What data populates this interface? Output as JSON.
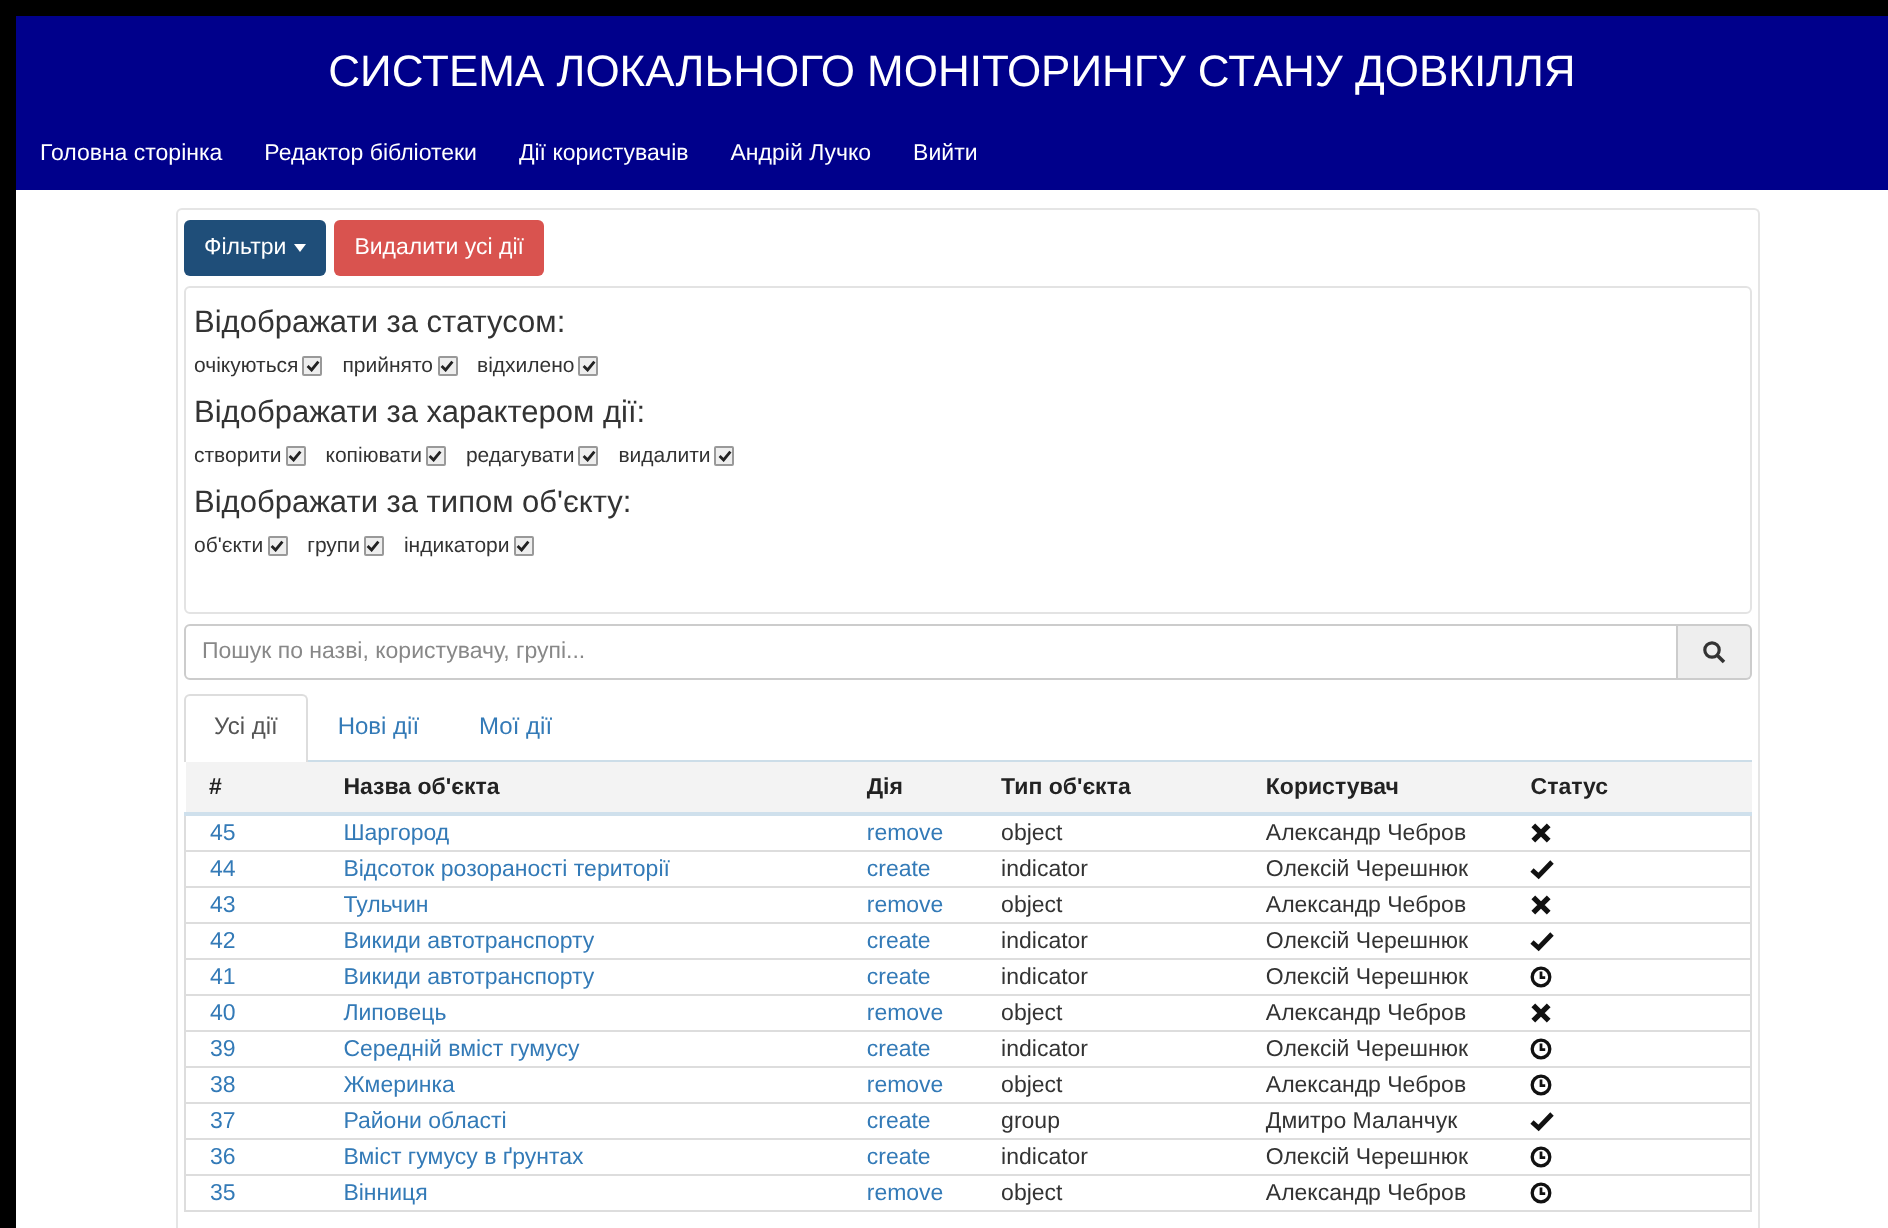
{
  "header": {
    "title": "СИСТЕМА ЛОКАЛЬНОГО МОНІТОРИНГУ СТАНУ ДОВКІЛЛЯ",
    "nav": [
      "Головна сторінка",
      "Редактор бібліотеки",
      "Дії користувачів",
      "Андрій Лучко",
      "Вийти"
    ]
  },
  "toolbar": {
    "filters_button": "Фільтри",
    "delete_button": "Видалити усі дії"
  },
  "filters": [
    {
      "heading": "Відображати за статусом:",
      "options": [
        {
          "label": "очікуються",
          "checked": true
        },
        {
          "label": "прийнято",
          "checked": true
        },
        {
          "label": "відхилено",
          "checked": true
        }
      ]
    },
    {
      "heading": "Відображати за характером дії:",
      "options": [
        {
          "label": "створити",
          "checked": true
        },
        {
          "label": "копіювати",
          "checked": true
        },
        {
          "label": "редагувати",
          "checked": true
        },
        {
          "label": "видалити",
          "checked": true
        }
      ]
    },
    {
      "heading": "Відображати за типом об'єкту:",
      "options": [
        {
          "label": "об'єкти",
          "checked": true
        },
        {
          "label": "групи",
          "checked": true
        },
        {
          "label": "індикатори",
          "checked": true
        }
      ]
    }
  ],
  "search": {
    "placeholder": "Пошук по назві, користувачу, групі..."
  },
  "tabs": [
    {
      "label": "Усі дії",
      "selected": true
    },
    {
      "label": "Нові дії",
      "selected": false
    },
    {
      "label": "Мої дії",
      "selected": false
    }
  ],
  "table": {
    "columns": [
      "#",
      "Назва об'єкта",
      "Дія",
      "Тип об'єкта",
      "Користувач",
      "Статус"
    ],
    "rows": [
      {
        "id": "45",
        "name": "Шаргород",
        "action": "remove",
        "type": "object",
        "user": "Александр Чебров",
        "kind": "rejected"
      },
      {
        "id": "44",
        "name": "Відсоток розораності території",
        "action": "create",
        "type": "indicator",
        "user": "Олексій Черешнюк",
        "kind": "accepted"
      },
      {
        "id": "43",
        "name": "Тульчин",
        "action": "remove",
        "type": "object",
        "user": "Александр Чебров",
        "kind": "rejected"
      },
      {
        "id": "42",
        "name": "Викиди автотранспорту",
        "action": "create",
        "type": "indicator",
        "user": "Олексій Черешнюк",
        "kind": "accepted"
      },
      {
        "id": "41",
        "name": "Викиди автотранспорту",
        "action": "create",
        "type": "indicator",
        "user": "Олексій Черешнюк",
        "kind": "pending"
      },
      {
        "id": "40",
        "name": "Липовець",
        "action": "remove",
        "type": "object",
        "user": "Александр Чебров",
        "kind": "rejected"
      },
      {
        "id": "39",
        "name": "Середній вміст гумусу",
        "action": "create",
        "type": "indicator",
        "user": "Олексій Черешнюк",
        "kind": "pending"
      },
      {
        "id": "38",
        "name": "Жмеринка",
        "action": "remove",
        "type": "object",
        "user": "Александр Чебров",
        "kind": "pending"
      },
      {
        "id": "37",
        "name": "Райони області",
        "action": "create",
        "type": "group",
        "user": "Дмитро Маланчук",
        "kind": "accepted"
      },
      {
        "id": "36",
        "name": "Вміст гумусу в ґрунтах",
        "action": "create",
        "type": "indicator",
        "user": "Олексій Черешнюк",
        "kind": "pending"
      },
      {
        "id": "35",
        "name": "Вінниця",
        "action": "remove",
        "type": "object",
        "user": "Александр Чебров",
        "kind": "pending"
      }
    ]
  }
}
